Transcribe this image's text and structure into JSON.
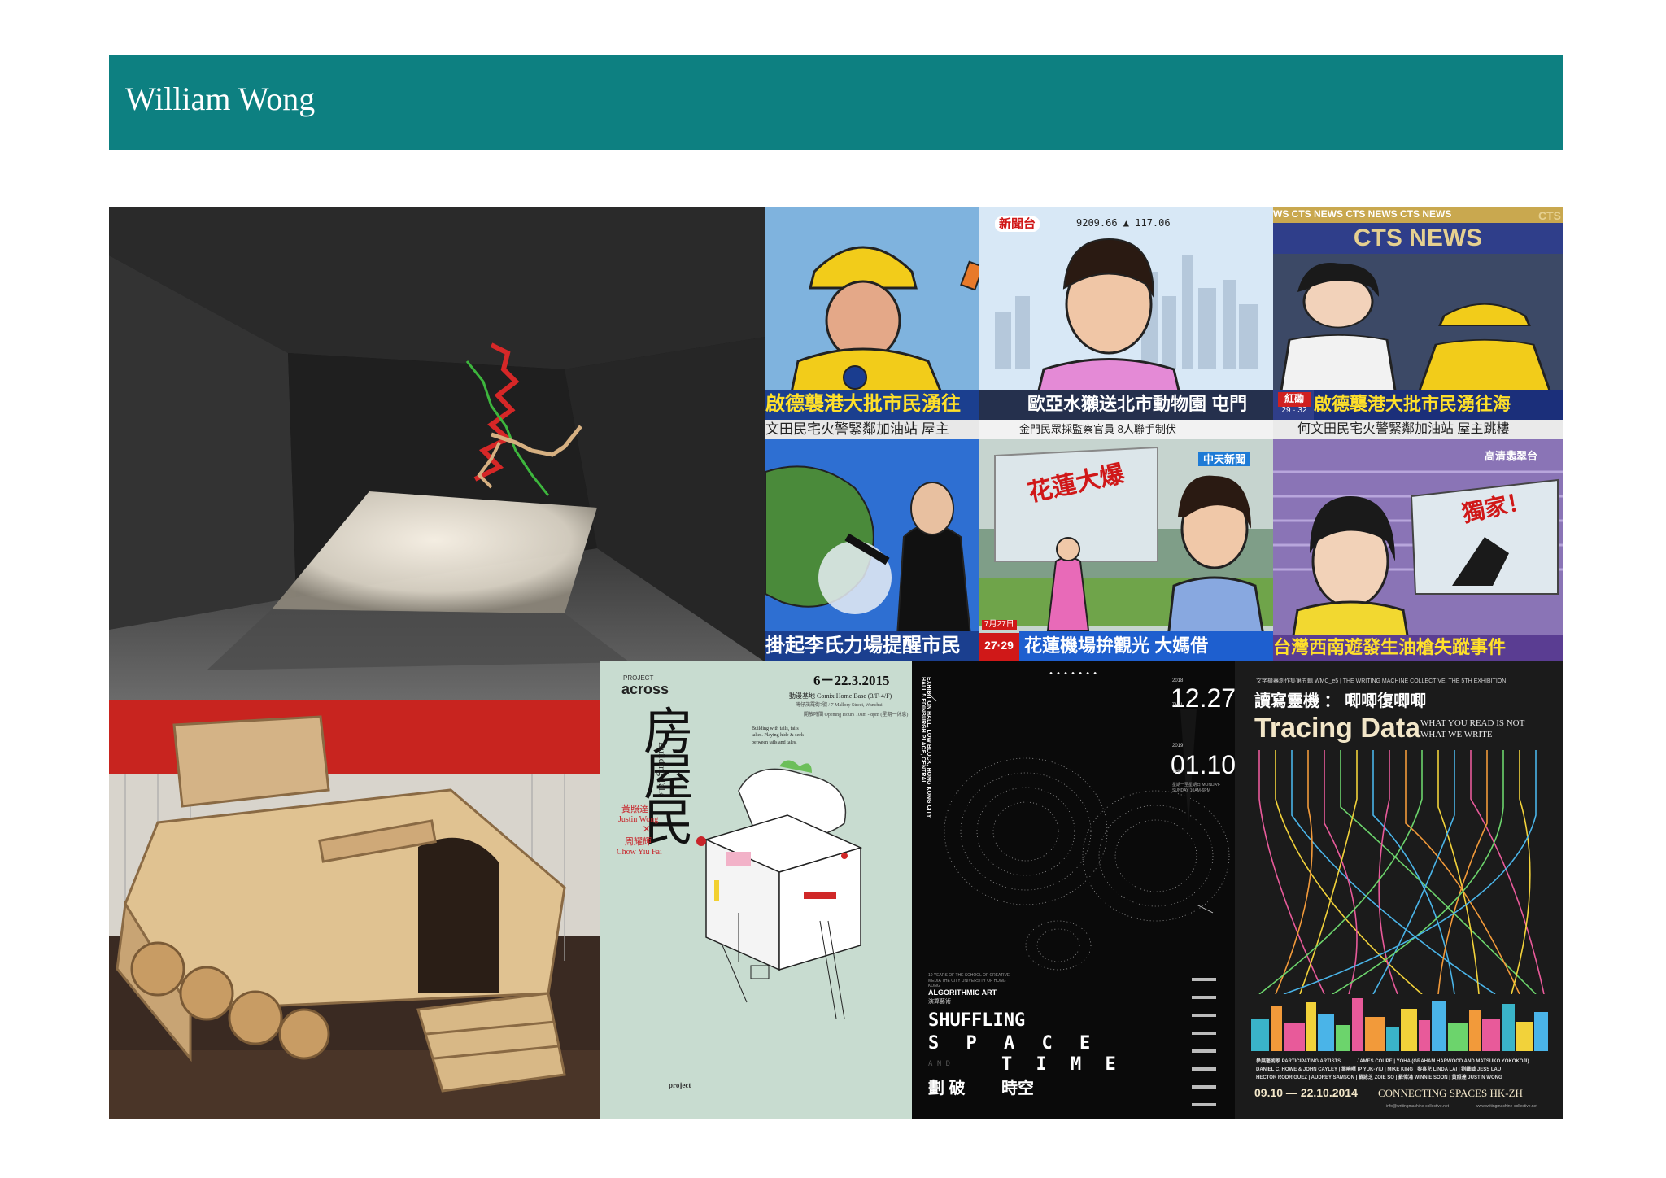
{
  "header": {
    "title": "William Wong"
  },
  "brand": {
    "header_bg": "#0d8081"
  },
  "news_grid": {
    "panels": [
      {
        "id": "p1",
        "caption": "啟德襲港大批市民湧往",
        "subcaption": "文田民宅火警緊鄰加油站 屋主"
      },
      {
        "id": "p2",
        "channel": "新聞台",
        "ticker": "9209.66 ▲ 117.06",
        "caption": "歐亞水獺送北市動物園 屯門",
        "subcaption": "金門民眾採監察官員 8人聯手制伏"
      },
      {
        "id": "p3",
        "banner": "CTS NEWS",
        "top_ticker": "WS CTS NEWS CTS NEWS CTS NEWS",
        "corner": "CTS",
        "tag": "紅磡",
        "tag_sub": "29 · 32",
        "caption": "啟德襲港大批市民湧往海",
        "subcaption": "何文田民宅火警緊鄰加油站 屋主跳樓"
      },
      {
        "id": "p4",
        "caption": "掛起李氏力場提醒市民"
      },
      {
        "id": "p5",
        "channel": "中天新聞",
        "sign": "花蓮大爆",
        "time": "7月27日",
        "date_tag": "27·29",
        "caption": "花蓮機場拚觀光 大媽借"
      },
      {
        "id": "p6",
        "channel": "高清翡翠台",
        "exclusive": "獨家！",
        "caption": "台灣西南遊發生油槍失蹤事件"
      }
    ]
  },
  "poster_across": {
    "label_small": "PROJECT",
    "label_brand": "across",
    "dates": "6－22.3.2015",
    "venue": "動漫基地 Comix Home Base (3/F-4/F)",
    "venue_sub": "灣仔茂羅街7號 / 7 Mallory Street, Wanchai",
    "hours": "開放時間 Opening Hours 10am - 8pm (星期一休息)",
    "title_cn": "房屋民",
    "title_en": "Building Talk",
    "artist1_cn": "黃照達",
    "artist1_en": "Justin Wong",
    "artist2_cn": "周耀輝",
    "artist2_en": "Chow Yiu Fai",
    "blurb": "Building with tails, tails takes. Playing hide & seek between tails and tales.",
    "footer_brand": "project"
  },
  "poster_shuffling": {
    "date1_small": "2018",
    "date1": "12.27",
    "date1_day": "THU",
    "date2_small": "2019",
    "date2": "01.10",
    "date2_day": "THU",
    "hours": "星期一至星期日 MONDAY-SUNDAY 10AM-6PM",
    "side_text": "EXHIBITION HALL, LOW BLOCK, HONG KONG CITY HALL 5 EDINBURGH PLACE, CENTRAL",
    "ten_years": "10 YEARS OF THE SCHOOL OF CREATIVE MEDIA THE CITY UNIVERSITY OF HONG KONG",
    "category": "ALGORITHMIC ART",
    "category_cn": "演算藝術",
    "title1": "SHUFFLING",
    "title2": "S P A C E",
    "title3": "A N D",
    "title4": "T I M E",
    "title_cn1": "劃 破",
    "title_cn2": "時空"
  },
  "poster_tracing": {
    "topline": "文字機器創作集第五輯 WMC_e5 | THE WRITING MACHINE COLLECTIVE, THE 5TH EXHIBITION",
    "title_cn": "讀寫靈機 ： 唧唧復唧唧",
    "title_en": "Tracing Data",
    "tagline1": "WHAT YOU READ IS NOT",
    "tagline2": "WHAT WE WRITE",
    "artists_label": "參展藝術家 PARTICIPATING ARTISTS",
    "artists1": "JAMES COUPE | YOHA (GRAHAM HARWOOD AND MATSUKO YOKOKOJI)",
    "artists2": "DANIEL C. HOWE & JOHN CAYLEY | 葉曉暉 IP YUK-YIU | MIKE KING | 黎喜兒 LINDA LAI | 劉鐵鉞 JESS LAU",
    "artists3": "HECTOR RODRIGUEZ | AUDREY SAMSON | 蘇詠芝 ZOIE SO | 蘇偉鴻 WINNIE SOON | 黃照達 JUSTIN WONG",
    "dates": "09.10 — 22.10.2014",
    "connecting": "CONNECTING SPACES HK-ZH",
    "web": "info@writingmachine-collective.net",
    "web2": "www.writingmachine-collective.net"
  }
}
